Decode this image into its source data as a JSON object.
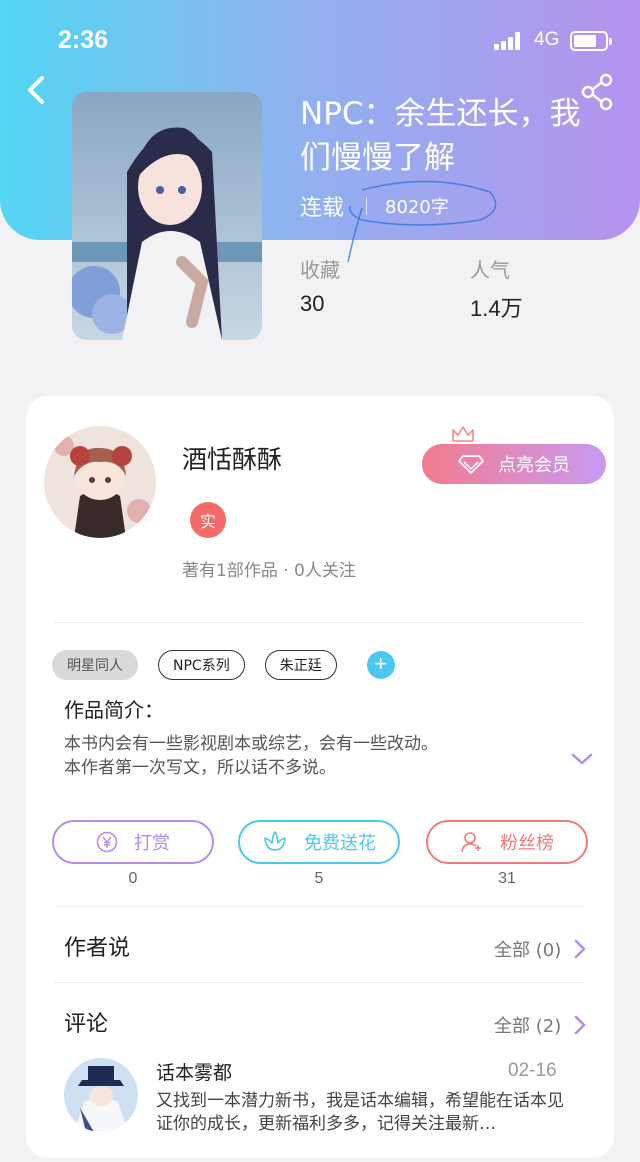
{
  "status_bar": {
    "time": "2:36",
    "network": "4G"
  },
  "book": {
    "title": "NPC：余生还长，我们慢慢了解",
    "status": "连载",
    "word_count": "8020字",
    "stats": [
      {
        "label": "收藏",
        "value": "30"
      },
      {
        "label": "人气",
        "value": "1.4万"
      }
    ]
  },
  "author": {
    "name": "酒恬酥酥",
    "badge": "实",
    "info": "著有1部作品 · 0人关注",
    "member_button": "点亮会员"
  },
  "tags": [
    "明星同人",
    "NPC系列",
    "朱正廷"
  ],
  "intro": {
    "title": "作品简介：",
    "lines": [
      "本书内会有一些影视剧本或综艺，会有一些改动。",
      "本作者第一次写文，所以话不多说。"
    ]
  },
  "actions": [
    {
      "label": "打赏",
      "count": "0",
      "color": "#b48be8",
      "icon": "yen-icon"
    },
    {
      "label": "免费送花",
      "count": "5",
      "color": "#4cc8ee",
      "icon": "flower-icon"
    },
    {
      "label": "粉丝榜",
      "count": "31",
      "color": "#ee7b7b",
      "icon": "fan-ranking-icon"
    }
  ],
  "author_says": {
    "title": "作者说",
    "all": "全部 (0)"
  },
  "comments": {
    "title": "评论",
    "all": "全部 (2)",
    "items": [
      {
        "user": "话本雾都",
        "date": "02-16",
        "text": "又找到一本潜力新书，我是话本编辑，希望能在话本见证你的成长，更新福利多多，记得关注最新…"
      }
    ]
  },
  "colors": {
    "header_start": "#52d6f4",
    "header_end": "#b593ee",
    "accent_purple": "#b48be8"
  }
}
